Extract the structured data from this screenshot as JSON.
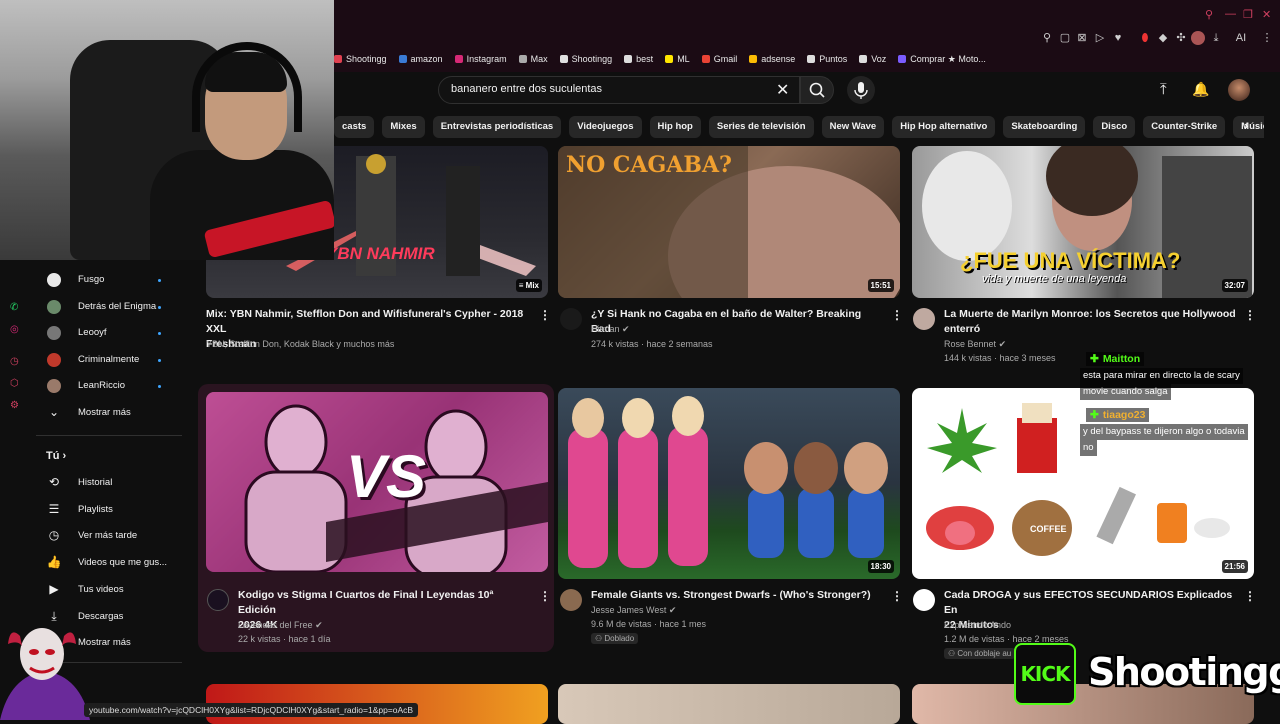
{
  "browser": {
    "bookmarks": [
      {
        "label": "Shootingg",
        "color": "#e04050"
      },
      {
        "label": "amazon",
        "color": "#3a7bd5"
      },
      {
        "label": "Instagram",
        "color": "#d62976"
      },
      {
        "label": "Max",
        "color": "#aaaaaa"
      },
      {
        "label": "Shootingg",
        "color": "#e0e0e0"
      },
      {
        "label": "best",
        "color": "#dddddd"
      },
      {
        "label": "ML",
        "color": "#ffe600"
      },
      {
        "label": "Gmail",
        "color": "#ea4335"
      },
      {
        "label": "adsense",
        "color": "#fbbc04"
      },
      {
        "label": "Puntos",
        "color": "#dddddd"
      },
      {
        "label": "Voz",
        "color": "#dddddd"
      },
      {
        "label": "Comprar ★ Moto...",
        "color": "#7b5cff"
      }
    ],
    "ai_label": "AI",
    "status_url": "youtube.com/watch?v=jcQDClH0XYg&list=RDjcQDClH0XYg&start_radio=1&pp=oAcB"
  },
  "search": {
    "value": "bananero entre dos suculentas"
  },
  "chips": [
    "casts",
    "Mixes",
    "Entrevistas periodísticas",
    "Videojuegos",
    "Hip hop",
    "Series de televisión",
    "New Wave",
    "Hip Hop alternativo",
    "Skateboarding",
    "Disco",
    "Counter-Strike",
    "Música dance"
  ],
  "sidebar": {
    "subscriptions": [
      {
        "label": "Fusgo",
        "color": "#e8e8e8"
      },
      {
        "label": "Detrás del Enigma",
        "color": "#6a8a6a"
      },
      {
        "label": "Leooyf",
        "color": "#777777"
      },
      {
        "label": "Criminalmente",
        "color": "#c0392b"
      },
      {
        "label": "LeanRiccio",
        "color": "#9a7a6a"
      }
    ],
    "show_more_1": "Mostrar más",
    "you_label": "Tú",
    "you_items": [
      {
        "label": "Historial",
        "icon": "history-icon"
      },
      {
        "label": "Playlists",
        "icon": "playlist-icon"
      },
      {
        "label": "Ver más tarde",
        "icon": "watch-later-icon"
      },
      {
        "label": "Videos que me gus...",
        "icon": "like-icon"
      },
      {
        "label": "Tus videos",
        "icon": "your-videos-icon"
      },
      {
        "label": "Descargas",
        "icon": "download-icon"
      }
    ],
    "show_more_2": "Mostrar más"
  },
  "videos": [
    {
      "title_1": "Mix: YBN Nahmir, Stefflon Don and Wifisfuneral's Cypher - 2018 XXL",
      "title_2": "Freshman",
      "channel": "YBN, Stefflon Don, Kodak Black y muchos más",
      "meta": "",
      "badge": "Mix",
      "thumb_text": "YBN NAHMIR"
    },
    {
      "title_1": "¿Y Si Hank no Cagaba en el baño de Walter? Breaking Bad",
      "title_2": "",
      "channel": "Hitman",
      "meta": "274 k vistas · hace 2 semanas",
      "duration": "15:51",
      "thumb_text": "NO CAGABA?"
    },
    {
      "title_1": "La Muerte de Marilyn Monroe: los Secretos que Hollywood",
      "title_2": "enterró",
      "channel": "Rose Bennet",
      "meta": "144 k vistas · hace 3 meses",
      "duration": "32:07",
      "thumb_text": "¿FUE UNA VÍCTIMA?",
      "thumb_sub": "vida y muerte de una leyenda"
    },
    {
      "title_1": "Kodigo vs Stigma I Cuartos de Final I Leyendas 10ª Edición",
      "title_2": "2026 4K",
      "channel": "Leyendas del Free",
      "meta": "22 k vistas · hace 1 día",
      "thumb_text": "VS"
    },
    {
      "title_1": "Female Giants vs. Strongest Dwarfs - (Who's Stronger?)",
      "title_2": "",
      "channel": "Jesse James West",
      "meta": "9.6 M de vistas · hace 1 mes",
      "duration": "18:30",
      "badge": "Doblado"
    },
    {
      "title_1": "Cada DROGA y sus EFECTOS SECUNDARIOS Explicados En",
      "title_2": "22 Minutos",
      "channel": "Explicando Ando",
      "meta": "1.2 M de vistas · hace 2 meses",
      "duration": "21:56",
      "badge": "Con doblaje au",
      "thumb_text": "COFFEE"
    }
  ],
  "chat": [
    {
      "user": "Maitton",
      "color": "#53fc18",
      "lines": [
        "esta para mirar en directo la de scary",
        "movie cuando salga"
      ]
    },
    {
      "user": "tiaago23",
      "color": "#f0b030",
      "lines": [
        "y del baypass te dijeron algo o todavia",
        "no"
      ]
    }
  ],
  "overlay": {
    "kick": "KICK",
    "streamer": "Shootingg"
  }
}
